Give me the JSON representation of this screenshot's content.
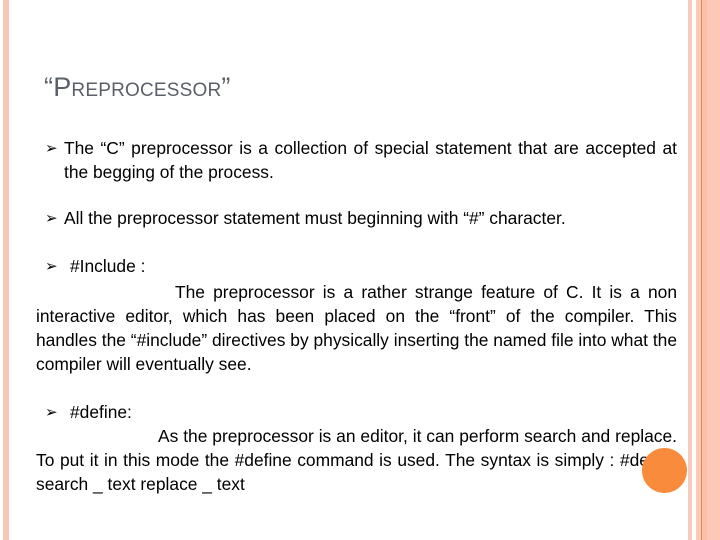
{
  "slide": {
    "title": {
      "open_quote": "“",
      "text": "Preprocessor",
      "close_quote": "”"
    },
    "bullet_icon": "arrowhead-bullet-icon",
    "bullet_glyph": "➢",
    "bullets": [
      {
        "text": "The “C” preprocessor is a collection of special statement that are accepted at the begging of the process."
      },
      {
        "text": "All the preprocessor statement must beginning with “#” character."
      },
      {
        "heading": "#Include :",
        "body": "The preprocessor is a rather strange feature of C. It is a non interactive editor, which has been placed on the “front” of the compiler. This handles the “#include” directives by physically inserting the named file into what the compiler will eventually see."
      },
      {
        "heading": "#define:",
        "body": "As the preprocessor is an editor, it can perform search and replace. To put it in this mode the #define command is used. The syntax is simply : #define search _ text replace _ text"
      }
    ],
    "colors": {
      "title": "#5b6068",
      "accent_circle": "#f98b3c",
      "border_stripe": "#fdc8b5"
    }
  }
}
